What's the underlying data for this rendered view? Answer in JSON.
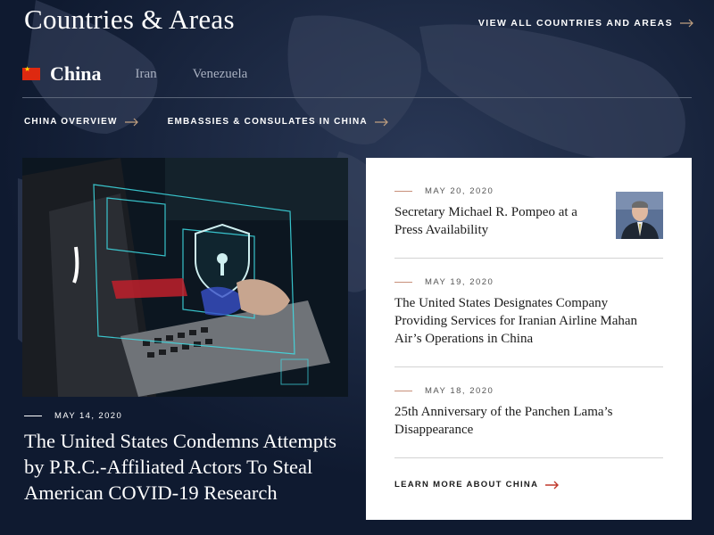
{
  "header": {
    "title": "Countries & Areas",
    "view_all": "VIEW ALL COUNTRIES AND AREAS"
  },
  "tabs": [
    {
      "label": "China",
      "active": true
    },
    {
      "label": "Iran",
      "active": false
    },
    {
      "label": "Venezuela",
      "active": false
    }
  ],
  "subnav": [
    {
      "label": "CHINA OVERVIEW"
    },
    {
      "label": "EMBASSIES & CONSULATES IN CHINA"
    }
  ],
  "feature": {
    "date": "MAY 14, 2020",
    "title": "The United States Condemns Attempts by P.R.C.-Affiliated Actors To Steal American COVID-19 Research"
  },
  "news": [
    {
      "date": "MAY 20, 2020",
      "title": "Secretary Michael R. Pompeo at a Press Availability"
    },
    {
      "date": "MAY 19, 2020",
      "title": "The United States Designates Company Providing Services for Iranian Airline Mahan Air’s Operations in China"
    },
    {
      "date": "MAY 18, 2020",
      "title": "25th Anniversary of the Panchen Lama’s Disappearance"
    }
  ],
  "learn_more": "LEARN MORE ABOUT CHINA",
  "colors": {
    "background": "#0f1a30",
    "accent_arrow": "#c0392b",
    "flag_red": "#de2910"
  }
}
